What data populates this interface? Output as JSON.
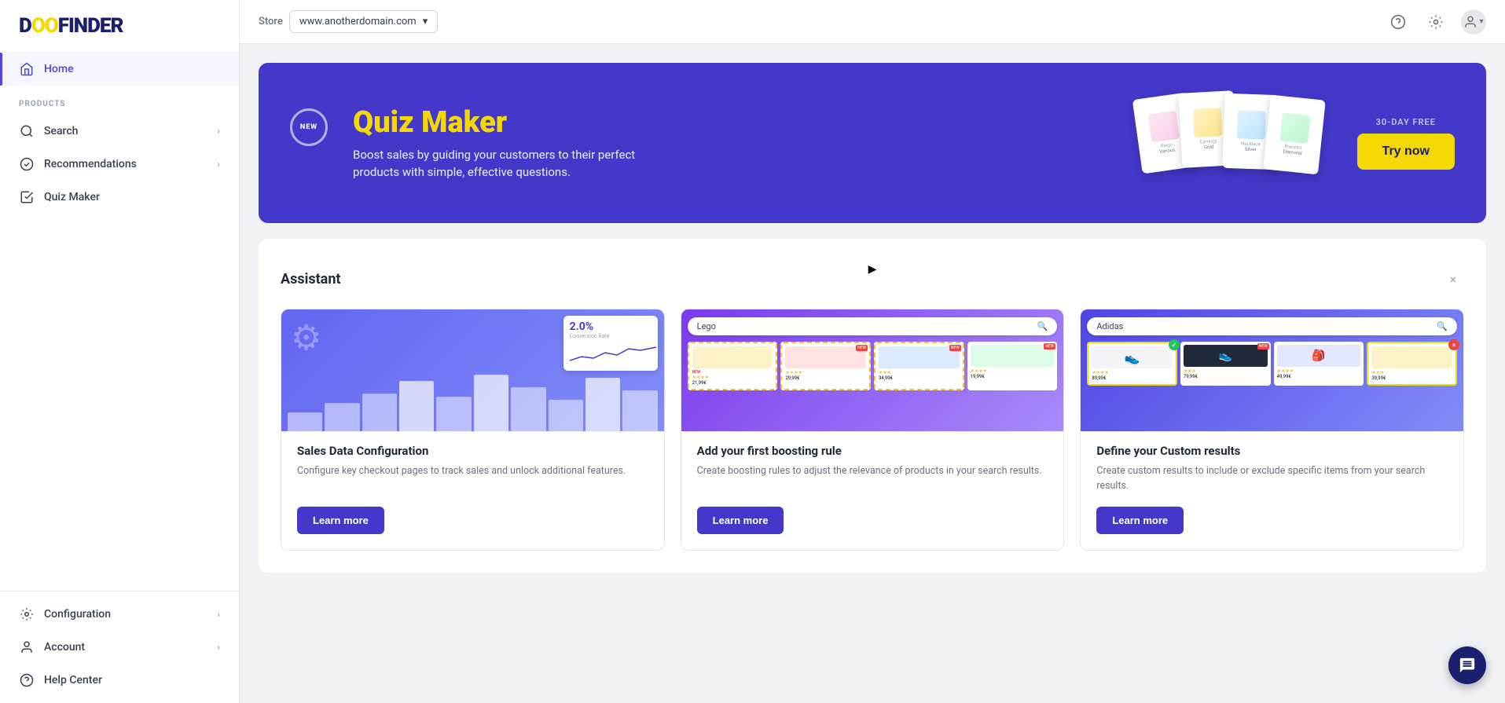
{
  "app": {
    "logo": "DOOFINDER",
    "logo_accent": "O"
  },
  "topbar": {
    "store_label": "Store",
    "store_url": "www.anotherdomain.com",
    "help_icon": "?",
    "settings_icon": "⚙",
    "user_icon": "👤"
  },
  "sidebar": {
    "home_label": "Home",
    "products_section": "PRODUCTS",
    "search_label": "Search",
    "recommendations_label": "Recommendations",
    "quiz_maker_label": "Quiz Maker",
    "configuration_label": "Configuration",
    "account_label": "Account",
    "help_center_label": "Help Center"
  },
  "banner": {
    "new_badge": "NEW",
    "title": "Quiz Maker",
    "subtitle": "Boost sales by guiding your customers to their perfect products with simple, effective questions.",
    "free_label": "30-DAY FREE",
    "cta_button": "Try now"
  },
  "assistant": {
    "title": "Assistant",
    "close_icon": "×",
    "cards": [
      {
        "id": "sales-data",
        "title": "Sales Data Configuration",
        "description": "Configure key checkout pages to track sales and unlock additional features.",
        "learn_more": "Learn more",
        "chart_label": "2.0%",
        "chart_sublabel": "Conversion Rate"
      },
      {
        "id": "boosting-rule",
        "title": "Add your first boosting rule",
        "description": "Create boosting rules to adjust the relevance of products in your search results.",
        "learn_more": "Learn more",
        "search_placeholder": "Lego"
      },
      {
        "id": "custom-results",
        "title": "Define your Custom results",
        "description": "Create custom results to include or exclude specific items from your search results.",
        "learn_more": "Learn more",
        "search_placeholder": "Adidas"
      }
    ]
  },
  "chat": {
    "icon": "💬"
  }
}
